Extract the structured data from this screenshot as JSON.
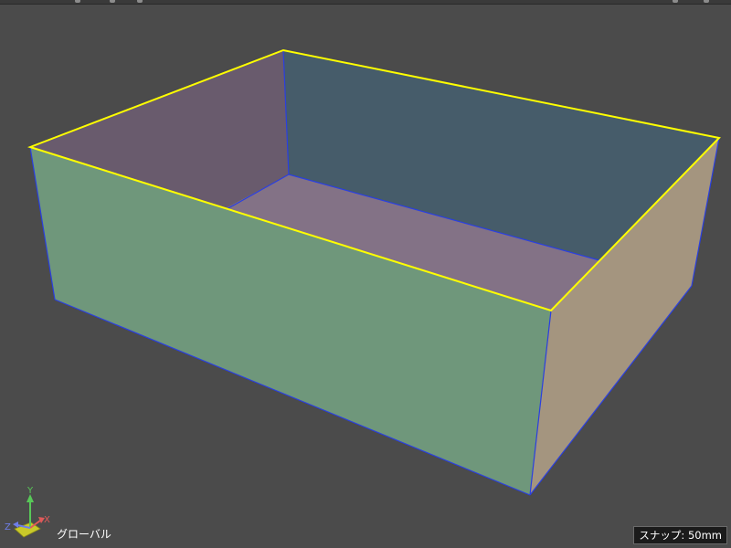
{
  "viewport": {
    "coordinate_system_label": "グローバル",
    "snap_label": "スナップ: 50mm",
    "background_color": "#4b4b4b"
  },
  "axis_gizmo": {
    "x_label": "X",
    "y_label": "Y",
    "z_label": "Z",
    "x_color": "#e05a5a",
    "y_color": "#58c858",
    "z_color": "#6e7ee8"
  },
  "model": {
    "object": "open-top box",
    "top_edge_color": "#ffff00",
    "edge_color": "#2a3fe0",
    "face_colors": {
      "front_outer": "#6f977b",
      "right_outer": "#a4957f",
      "back_inner": "#465c6a",
      "left_inner": "#695b6d",
      "floor_inner": "#837286"
    }
  }
}
